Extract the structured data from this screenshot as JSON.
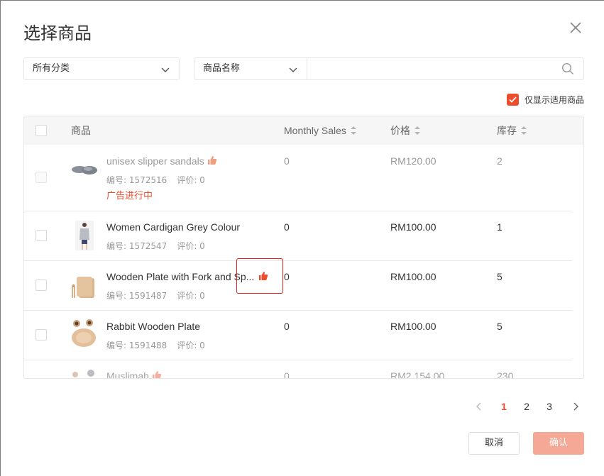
{
  "dialog": {
    "title": "选择商品",
    "close_icon": "close-icon"
  },
  "filters": {
    "category": "所有分类",
    "search_field": "商品名称",
    "search_value": "",
    "search_placeholder": ""
  },
  "only_applicable": {
    "label": "仅显示适用商品",
    "checked": true
  },
  "table": {
    "headers": {
      "product": "商品",
      "monthly_sales": "Monthly Sales",
      "price": "价格",
      "stock": "库存"
    },
    "rows": [
      {
        "name": "unisex slipper sandals",
        "sku": "编号: 1572516",
        "rating": "评价: 0",
        "badge": "广告进行中",
        "monthly_sales": "0",
        "price": "RM120.00",
        "stock": "2",
        "recommended": true,
        "disabled": true
      },
      {
        "name": "Women Cardigan Grey Colour",
        "sku": "编号: 1572547",
        "rating": "评价: 0",
        "monthly_sales": "0",
        "price": "RM100.00",
        "stock": "1",
        "recommended": false,
        "disabled": false
      },
      {
        "name": "Wooden Plate with Fork and Sp...",
        "sku": "编号: 1591487",
        "rating": "评价: 0",
        "monthly_sales": "0",
        "price": "RM100.00",
        "stock": "5",
        "recommended": true,
        "disabled": false
      },
      {
        "name": "Rabbit Wooden Plate",
        "sku": "编号: 1591488",
        "rating": "评价: 0",
        "monthly_sales": "0",
        "price": "RM100.00",
        "stock": "5",
        "recommended": false,
        "disabled": false
      },
      {
        "name": "Muslimah",
        "monthly_sales": "0",
        "price": "RM2,154.00",
        "stock": "230",
        "recommended": true,
        "disabled": false
      }
    ]
  },
  "pagination": {
    "pages": [
      "1",
      "2",
      "3"
    ],
    "current": "1"
  },
  "footer": {
    "cancel": "取消",
    "confirm": "确认"
  },
  "colors": {
    "accent": "#ee4d2d",
    "confirm_disabled": "#f5a896",
    "highlight": "#e0201d"
  }
}
